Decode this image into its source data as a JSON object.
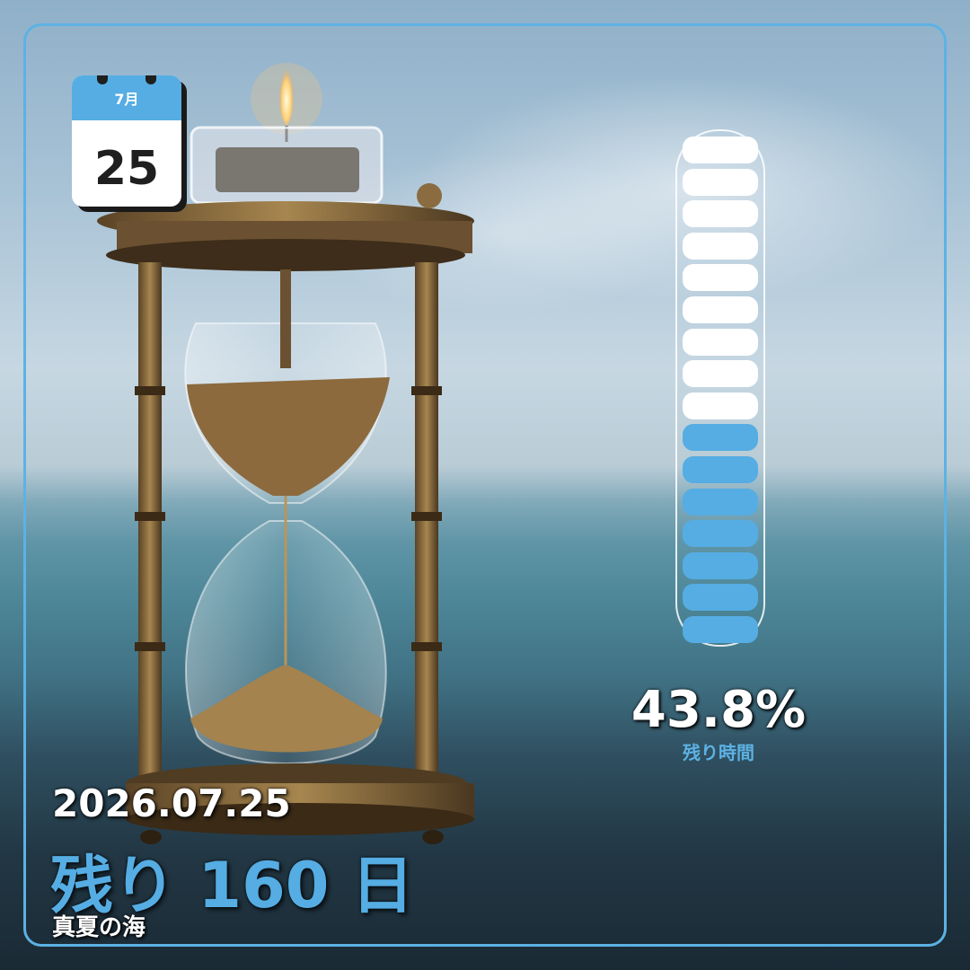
{
  "calendar": {
    "month": "7月",
    "day": "25"
  },
  "progress": {
    "percent_text": "43.8%",
    "label": "残り時間",
    "value": 0.438,
    "segments_total": 16,
    "segments_filled": 7
  },
  "footer": {
    "date": "2026.07.25",
    "remaining_prefix": "残り",
    "remaining_days": "160",
    "remaining_suffix": "日",
    "place": "真夏の海"
  },
  "colors": {
    "accent": "#55ade3",
    "frame": "#5cb2e4",
    "segment_empty": "#ffffff",
    "segment_filled": "#55ade3"
  }
}
